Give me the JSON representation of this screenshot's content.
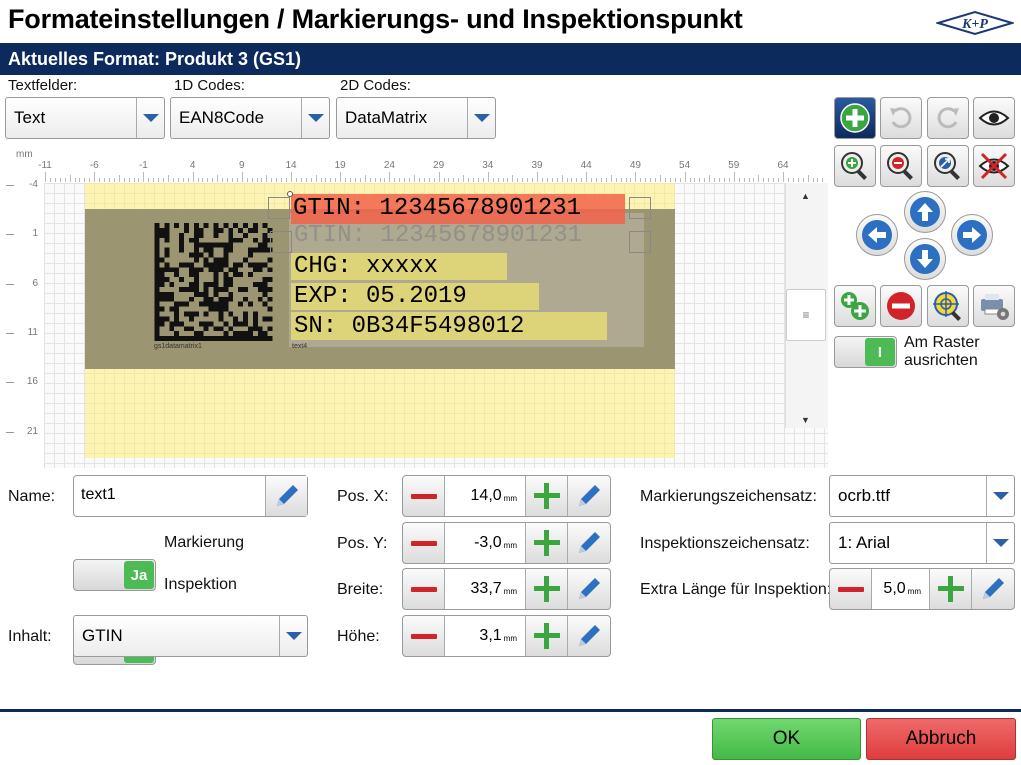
{
  "header": {
    "title": "Formateinstellungen / Markierungs- und Inspektionspunkt",
    "logo_text": "K+P"
  },
  "format_bar": {
    "label": "Aktuelles Format: Produkt 3 (GS1)"
  },
  "selectors": {
    "text": {
      "label": "Textfelder:",
      "value": "Text"
    },
    "codes1d": {
      "label": "1D Codes:",
      "value": "EAN8Code"
    },
    "codes2d": {
      "label": "2D Codes:",
      "value": "DataMatrix"
    }
  },
  "ruler": {
    "unit": "mm",
    "x_ticks": [
      "-11",
      "-6",
      "-1",
      "4",
      "9",
      "14",
      "19",
      "24",
      "29",
      "34",
      "39",
      "44",
      "49",
      "54",
      "59",
      "64"
    ],
    "y_ticks": [
      "-4",
      "1",
      "6",
      "11",
      "16",
      "21"
    ]
  },
  "preview": {
    "gtin_marker": "GTIN: 12345678901231",
    "gtin_print": "GTIN: 12345678901231",
    "lines": [
      "CHG: xxxxx",
      "EXP: 05.2019",
      "SN: 0B34F5498012"
    ],
    "datamatrix_label": "gs1datamatrix1",
    "text_label": "text4"
  },
  "tools": {
    "align_grid_label": "Am Raster ausrichten",
    "align_grid_state": "I"
  },
  "fields": {
    "name": {
      "label": "Name:",
      "value": "text1"
    },
    "marking": {
      "label": "Markierung",
      "state": "Ja"
    },
    "inspection": {
      "label": "Inspektion",
      "state": "Ja"
    },
    "content": {
      "label": "Inhalt:",
      "value": "GTIN"
    }
  },
  "position": {
    "x": {
      "label": "Pos. X:",
      "value": "14,0",
      "unit": "mm"
    },
    "y": {
      "label": "Pos. Y:",
      "value": "-3,0",
      "unit": "mm"
    },
    "width": {
      "label": "Breite:",
      "value": "33,7",
      "unit": "mm"
    },
    "height": {
      "label": "Höhe:",
      "value": "3,1",
      "unit": "mm"
    }
  },
  "fonts": {
    "marking": {
      "label": "Markierungszeichensatz:",
      "value": "ocrb.ttf"
    },
    "inspection": {
      "label": "Inspektionszeichensatz:",
      "value": "1: Arial"
    },
    "extra": {
      "label": "Extra Länge für Inspektion:",
      "value": "5,0",
      "unit": "mm"
    }
  },
  "footer": {
    "ok": "OK",
    "cancel": "Abbruch"
  },
  "colors": {
    "brand": "#0d2a5c",
    "ok": "#4cbb55",
    "cancel": "#e04444",
    "marker": "#f2634a"
  }
}
